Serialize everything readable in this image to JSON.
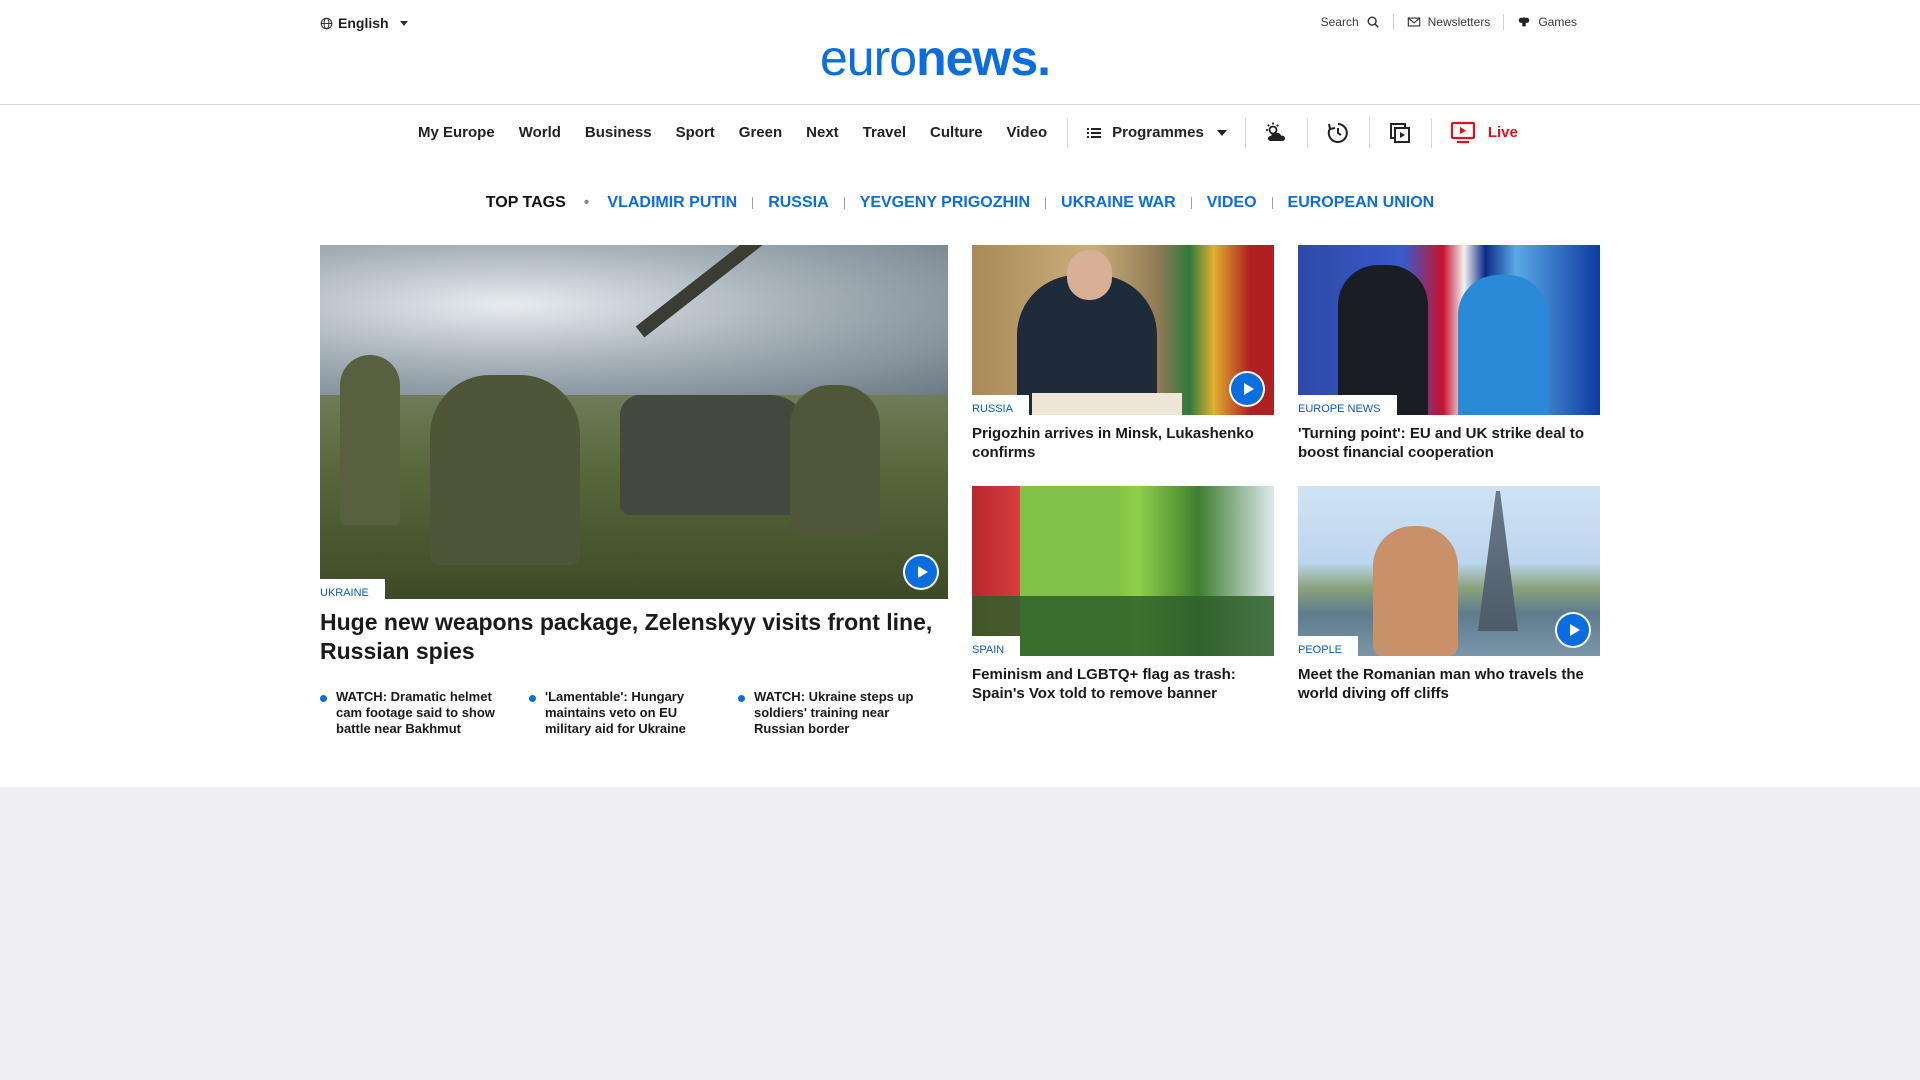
{
  "header": {
    "language": "English",
    "logo_light": "euro",
    "logo_bold": "news.",
    "search_label": "Search",
    "newsletters_label": "Newsletters",
    "games_label": "Games"
  },
  "nav": {
    "links": [
      "My Europe",
      "World",
      "Business",
      "Sport",
      "Green",
      "Next",
      "Travel",
      "Culture",
      "Video"
    ],
    "programmes_label": "Programmes",
    "live_label": "Live"
  },
  "top_tags": {
    "label": "TOP TAGS",
    "tags": [
      "Vladimir Putin",
      "Russia",
      "Yevgeny Prigozhin",
      "Ukraine war",
      "video",
      "European Union"
    ]
  },
  "hero": {
    "category": "UKRAINE",
    "title": "Huge new weapons package, Zelenskyy visits front line, Russian spies",
    "related": [
      "WATCH: Dramatic helmet cam footage said to show battle near Bakhmut",
      "'Lamentable': Hungary maintains veto on EU military aid for Ukraine",
      "WATCH: Ukraine steps up soldiers' training near Russian border"
    ]
  },
  "cards": [
    {
      "category": "RUSSIA",
      "title": "Prigozhin arrives in Minsk, Lukashenko confirms"
    },
    {
      "category": "EUROPE NEWS",
      "title": "'Turning point': EU and UK strike deal to boost financial cooperation"
    },
    {
      "category": "SPAIN",
      "title": "Feminism and LGBTQ+ flag as trash: Spain's Vox told to remove banner"
    },
    {
      "category": "PEOPLE",
      "title": "Meet the Romanian man who travels the world diving off cliffs"
    }
  ],
  "colors": {
    "accent": "#0a6de0",
    "live": "#e0101e",
    "page_bg": "#efeff2"
  }
}
